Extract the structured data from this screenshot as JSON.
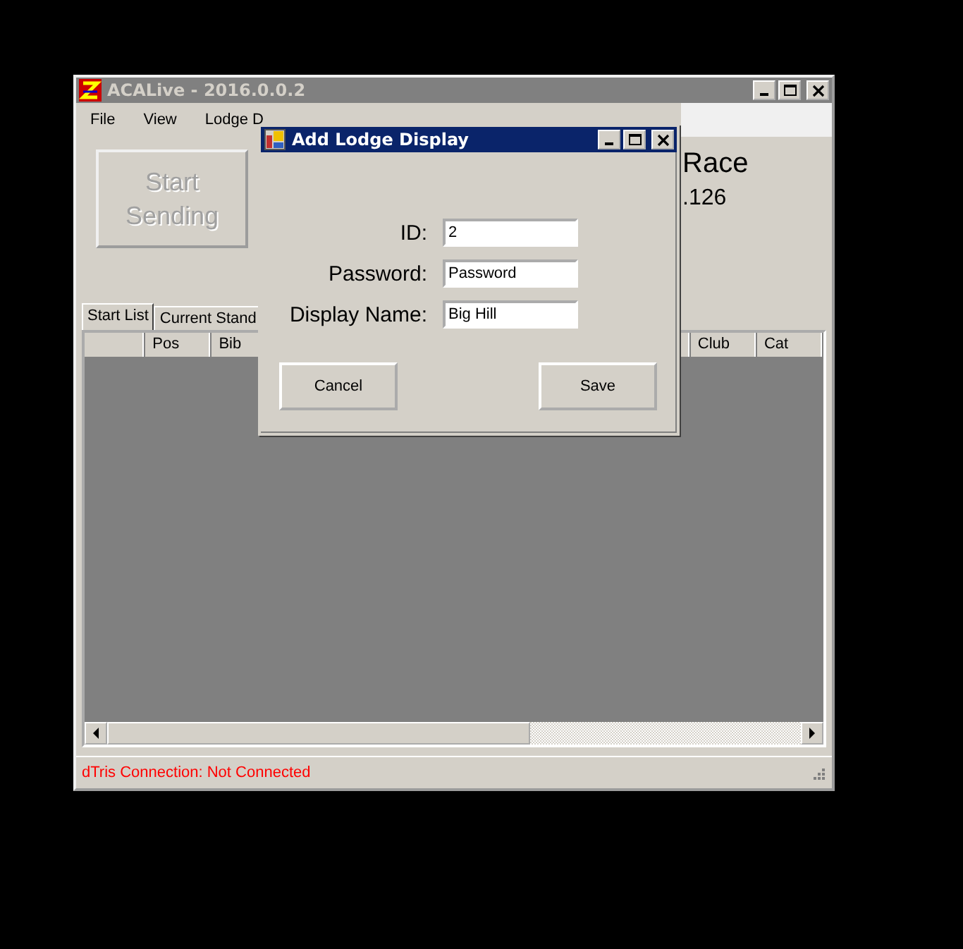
{
  "main_window": {
    "title": "ACALive - 2016.0.0.2",
    "menu": [
      "File",
      "View",
      "Lodge D"
    ],
    "start_button": {
      "label": "Start\nSending",
      "disabled": true
    },
    "race_title": "Race",
    "race_subtitle": ".126",
    "tabs": [
      {
        "label": "Start List",
        "selected": true
      },
      {
        "label": "Current Stand",
        "selected": false
      }
    ],
    "table": {
      "columns": [
        "",
        "Pos",
        "Bib",
        "Club",
        "Cat"
      ]
    },
    "status_bar": "dTris Connection: Not Connected"
  },
  "dialog": {
    "title": "Add Lodge Display",
    "fields": [
      {
        "label": "ID:",
        "value": "2"
      },
      {
        "label": "Password:",
        "value": "Password"
      },
      {
        "label": "Display Name:",
        "value": "Big Hill"
      }
    ],
    "buttons": [
      "Cancel",
      "Save"
    ]
  }
}
